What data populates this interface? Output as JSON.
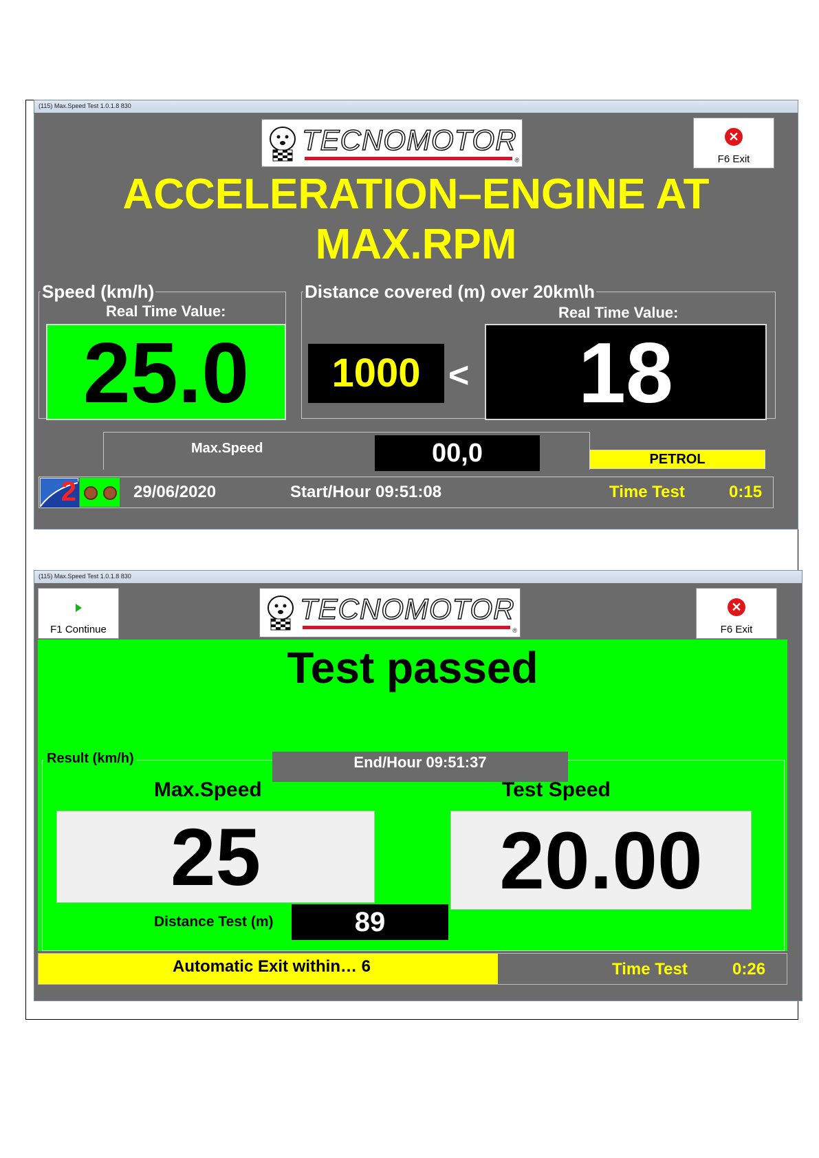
{
  "screen1": {
    "window_title": "(115) Max.Speed Test 1.0.1.8  830",
    "logo_text": "TECNOMOTOR",
    "exit_button": "F6 Exit",
    "heading_line1": "ACCELERATION–ENGINE AT",
    "heading_line2": "MAX.RPM",
    "speed_group": "Speed (km/h)",
    "speed_rt_label": "Real Time Value:",
    "speed_value": "25.0",
    "distance_group": "Distance covered (m) over 20km\\h",
    "distance_rt_label": "Real Time Value:",
    "distance_target": "1000",
    "comparator": "<",
    "distance_value": "18",
    "max_speed_label": "Max.Speed",
    "max_speed_value": "00,0",
    "fuel": "PETROL",
    "date": "29/06/2020",
    "start_hour": "Start/Hour 09:51:08",
    "time_test_label": "Time Test",
    "time_test_value": "0:15",
    "status_icon_text": "2"
  },
  "screen2": {
    "window_title": "(115) Max.Speed Test 1.0.1.8  830",
    "logo_text": "TECNOMOTOR",
    "continue_button": "F1 Continue",
    "exit_button": "F6 Exit",
    "heading": "Test passed",
    "result_group": "Result (km/h)",
    "end_hour": "End/Hour 09:51:37",
    "max_speed_label": "Max.Speed",
    "max_speed_value": "25",
    "test_speed_label": "Test Speed",
    "test_speed_value": "20.00",
    "distance_label": "Distance Test (m)",
    "distance_value": "89",
    "auto_exit": "Automatic Exit within… 6",
    "time_test_label": "Time Test",
    "time_test_value": "0:26"
  },
  "colors": {
    "panel_gray": "#6b6b6b",
    "bright_green": "#00ff00",
    "yellow": "#ffff00",
    "black": "#000000",
    "value_white": "#f0f0f0"
  }
}
